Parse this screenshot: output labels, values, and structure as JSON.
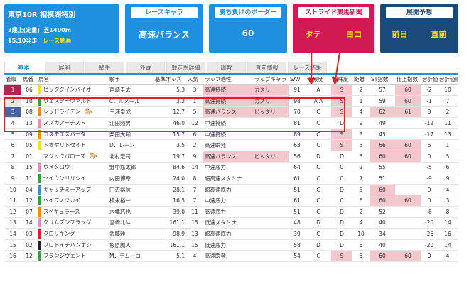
{
  "race": {
    "title": "東京10R 相模湖特別",
    "cond": "3歳上(定量)",
    "course": "芝1400m",
    "time": "15:10発走",
    "video": "レース動画"
  },
  "boxes": {
    "chara_label": "レースキャラ",
    "chara_value": "高速バランス",
    "border_label": "勝ち負けのボーダー",
    "border_value": "60",
    "stride_label": "ストライド競馬新聞",
    "stride_left": "タテ",
    "stride_right": "ヨコ",
    "forecast_label": "展開予想",
    "forecast_left": "前日",
    "forecast_right": "直前"
  },
  "tabs": [
    "基本",
    "展開",
    "騎手",
    "外厩",
    "競走馬詳細",
    "調教",
    "直前情報",
    "レース結果"
  ],
  "columns": [
    "着順",
    "馬番",
    "馬名",
    "騎手",
    "基準オッズ",
    "人気",
    "ラップ適性",
    "ラップキャラ",
    "SAV",
    "信頼度",
    "妙味度",
    "距離",
    "ST指数",
    "仕上指数",
    "合計値",
    "合計値順位"
  ],
  "rows": [
    {
      "rank": "1",
      "num": "06",
      "cap": "#ffe100",
      "name": "ビッククインバイオ",
      "jockey": "戸崎圭太",
      "odds": "5.3",
      "pop": "3",
      "lap": "高速持続",
      "chara": "カスリ",
      "sav": "91",
      "trust": "A",
      "value": "S",
      "dist": "2",
      "st": "57",
      "fin": "60",
      "sum": "-2",
      "sumr": "10",
      "mark": ""
    },
    {
      "rank": "2",
      "num": "10",
      "cap": "#2aa63a",
      "name": "ヴェスターヴァルト",
      "jockey": "C．ルメール",
      "odds": "3.2",
      "pop": "1",
      "lap": "高速持続",
      "chara": "カスリ",
      "sav": "98",
      "trust": "ＡＡ",
      "value": "S",
      "dist": "1",
      "st": "59",
      "fin": "60",
      "sum": "-1",
      "sumr": "7",
      "mark": ""
    },
    {
      "rank": "3",
      "num": "08",
      "cap": "#ff8a00",
      "name": "レッドライデン",
      "jockey": "三浦皇成",
      "odds": "12.7",
      "pop": "5",
      "lap": "高速バランス",
      "chara": "ピッタリ",
      "sav": "70",
      "trust": "C",
      "value": "S",
      "dist": "4",
      "st": "62",
      "fin": "61",
      "sum": "3",
      "sumr": "2",
      "mark": "🐎"
    },
    {
      "rank": "4",
      "num": "13",
      "cap": "#f28ab2",
      "name": "スズカアーチスト",
      "jockey": "江田照男",
      "odds": "46.0",
      "pop": "12",
      "lap": "中速持続",
      "chara": "",
      "sav": "81",
      "trust": "C",
      "value": "D",
      "dist": "9",
      "st": "49",
      "fin": "",
      "sum": "-12",
      "sumr": "11",
      "mark": ""
    },
    {
      "rank": "5",
      "num": "09",
      "cap": "#ff8a00",
      "name": "コスモエスパーダ",
      "jockey": "柴田大知",
      "odds": "15.7",
      "pop": "6",
      "lap": "中速持続",
      "chara": "",
      "sav": "89",
      "trust": "C",
      "value": "S",
      "dist": "3",
      "st": "45",
      "fin": "",
      "sum": "-17",
      "sumr": "13",
      "mark": ""
    },
    {
      "rank": "6",
      "num": "05",
      "cap": "#ffe100",
      "name": "トオヤリトセイト",
      "jockey": "D．レーン",
      "odds": "3.5",
      "pop": "2",
      "lap": "高速瞬発",
      "chara": "",
      "sav": "63",
      "trust": "C",
      "value": "S",
      "dist": "3",
      "st": "66",
      "fin": "60",
      "sum": "6",
      "sumr": "1",
      "mark": ""
    },
    {
      "rank": "7",
      "num": "01",
      "cap": "#ffffff",
      "name": "マジックバローズ",
      "jockey": "北村宏司",
      "odds": "19.7",
      "pop": "9",
      "lap": "高速バランス",
      "chara": "ピッタリ",
      "sav": "56",
      "trust": "D",
      "value": "D",
      "dist": "3",
      "st": "60",
      "fin": "60",
      "sum": "0",
      "sumr": "5",
      "mark": "🐎"
    },
    {
      "rank": "8",
      "num": "15",
      "cap": "#f28ab2",
      "name": "ウメタロウ",
      "jockey": "野中悠太郎",
      "odds": "84.6",
      "pop": "14",
      "lap": "中速底力",
      "chara": "",
      "sav": "64",
      "trust": "C",
      "value": "C",
      "dist": "2",
      "st": "55",
      "fin": "",
      "sum": "-5",
      "sumr": "6",
      "mark": ""
    },
    {
      "rank": "9",
      "num": "11",
      "cap": "#2aa63a",
      "name": "セイウンリリシイ",
      "jockey": "内田博幸",
      "odds": "24.0",
      "pop": "8",
      "lap": "超高速スタミナ",
      "chara": "",
      "sav": "61",
      "trust": "C",
      "value": "C",
      "dist": "7",
      "st": "51",
      "fin": "",
      "sum": "-9",
      "sumr": "9",
      "mark": ""
    },
    {
      "rank": "10",
      "num": "04",
      "cap": "#3a8fd8",
      "name": "キャッチミーアップ",
      "jockey": "田辺裕信",
      "odds": "28.1",
      "pop": "7",
      "lap": "超高速底力",
      "chara": "",
      "sav": "51",
      "trust": "C",
      "value": "D",
      "dist": "5",
      "st": "60",
      "fin": "",
      "sum": "0",
      "sumr": "4",
      "mark": ""
    },
    {
      "rank": "11",
      "num": "12",
      "cap": "#2aa63a",
      "name": "ヘイワノツカイ",
      "jockey": "横永裕一",
      "odds": "16.5",
      "pop": "7",
      "lap": "中速底力",
      "chara": "",
      "sav": "61",
      "trust": "C",
      "value": "C",
      "dist": "6",
      "st": "60",
      "fin": "60",
      "sum": "0",
      "sumr": "3",
      "mark": ""
    },
    {
      "rank": "12",
      "num": "07",
      "cap": "#ff8a00",
      "name": "スペキュラース",
      "jockey": "木幡巧也",
      "odds": "39.0",
      "pop": "11",
      "lap": "高速底力",
      "chara": "",
      "sav": "51",
      "trust": "C",
      "value": "D",
      "dist": "2",
      "st": "52",
      "fin": "",
      "sum": "-8",
      "sumr": "8",
      "mark": ""
    },
    {
      "rank": "13",
      "num": "14",
      "cap": "#f28ab2",
      "name": "クリムズンフラッグ",
      "jockey": "宮崎北斗",
      "odds": "161.1",
      "pop": "15",
      "lap": "低速スタミナ",
      "chara": "",
      "sav": "48",
      "trust": "D",
      "value": "D",
      "dist": "4",
      "st": "40",
      "fin": "",
      "sum": "-20",
      "sumr": "14",
      "mark": ""
    },
    {
      "rank": "14",
      "num": "03",
      "cap": "#e02020",
      "name": "クロリキング",
      "jockey": "武藤雅",
      "odds": "98.9",
      "pop": "13",
      "lap": "超高速底力",
      "chara": "",
      "sav": "39",
      "trust": "C",
      "value": "D",
      "dist": "10",
      "st": "34",
      "fin": "",
      "sum": "-26",
      "sumr": "16",
      "mark": ""
    },
    {
      "rank": "15",
      "num": "02",
      "cap": "#222222",
      "name": "プロトイチバンボシ",
      "jockey": "杉原誠人",
      "odds": "161.1",
      "pop": "15",
      "lap": "低速底力",
      "chara": "",
      "sav": "58",
      "trust": "D",
      "value": "D",
      "dist": "6",
      "st": "40",
      "fin": "",
      "sum": "-20",
      "sumr": "14",
      "mark": ""
    },
    {
      "rank": "16",
      "num": "12",
      "cap": "#2aa63a",
      "name": "フランジヴェント",
      "jockey": "M．デムーロ",
      "odds": "5.1",
      "pop": "4",
      "lap": "高速瞬発",
      "chara": "",
      "sav": "54",
      "trust": "C",
      "value": "S",
      "dist": "5",
      "st": "60",
      "fin": "60",
      "sum": "0",
      "sumr": "4",
      "mark": ""
    }
  ]
}
